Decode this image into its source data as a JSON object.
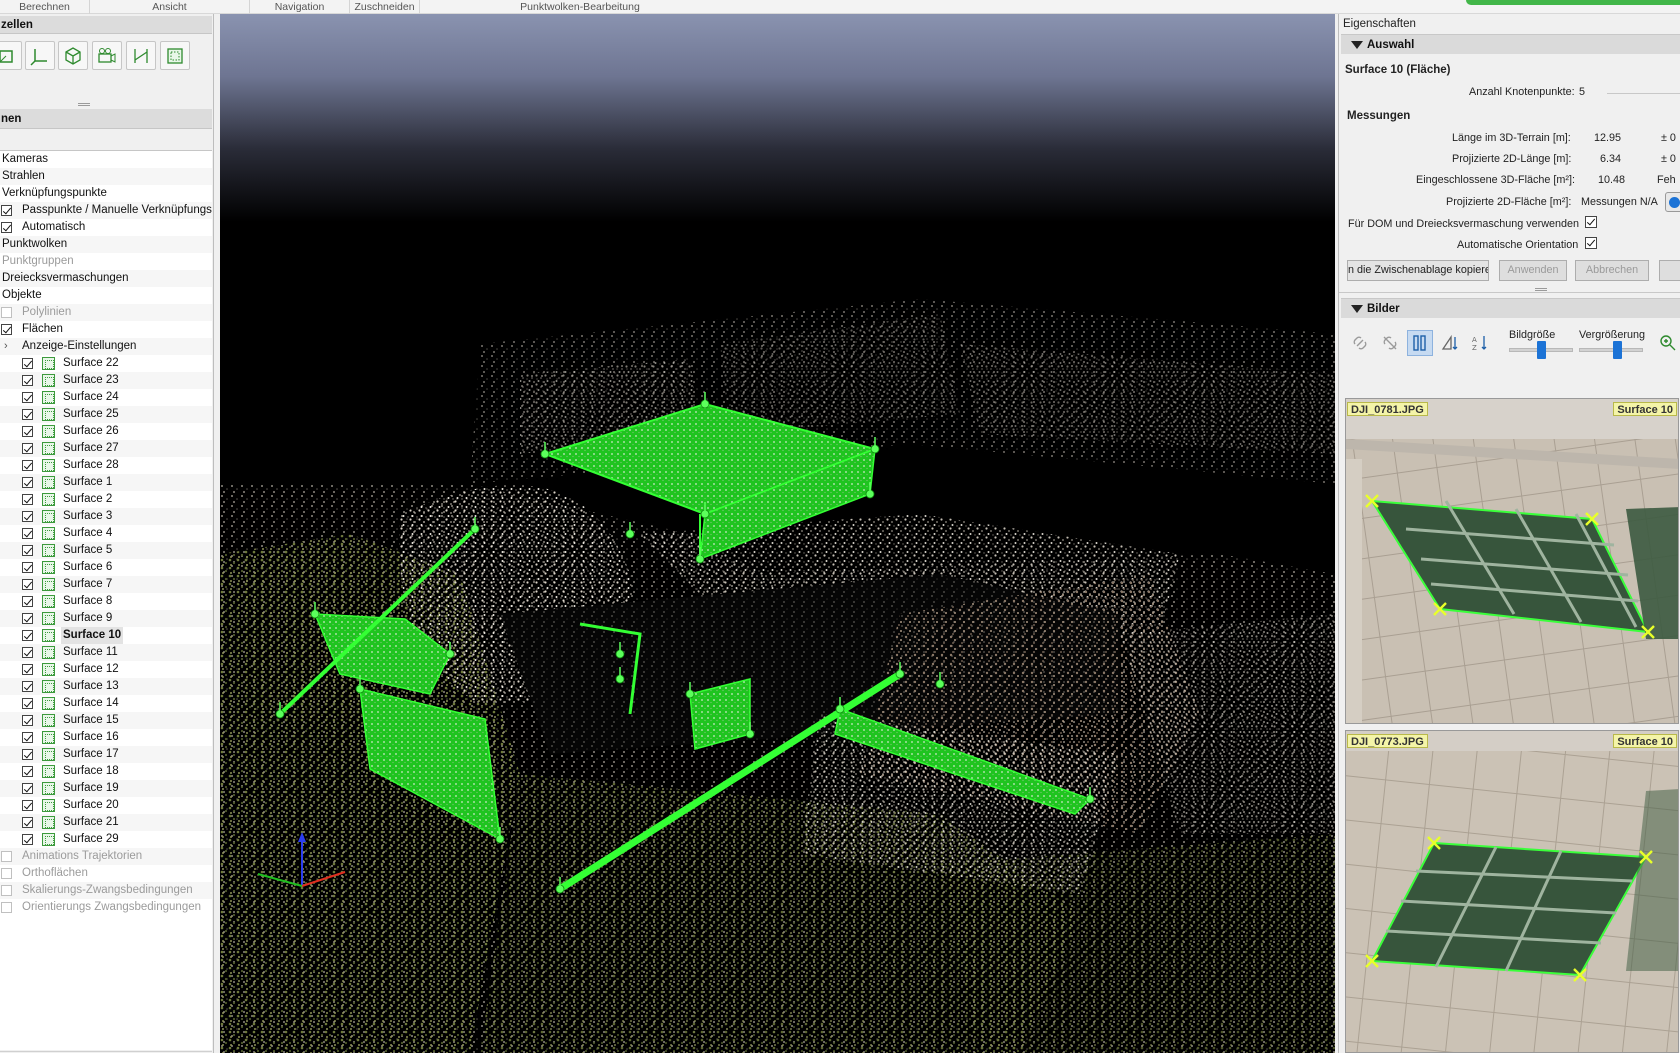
{
  "ribbon": {
    "groups": [
      "Berechnen",
      "Ansicht",
      "Navigation",
      "Zuschneiden",
      "Punktwolken-Bearbeitung"
    ]
  },
  "left": {
    "panel1_title": "zellen",
    "panel2_title": "nen",
    "tree": [
      {
        "label": "Kameras",
        "indent": 0,
        "checkbox": "none",
        "state": "normal"
      },
      {
        "label": "Strahlen",
        "indent": 0,
        "checkbox": "none",
        "state": "normal"
      },
      {
        "label": "Verknüpfungspunkte",
        "indent": 0,
        "checkbox": "none",
        "state": "normal"
      },
      {
        "label": "Passpunkte / Manuelle Verknüpfungspunkte",
        "indent": 0,
        "checkbox": "on",
        "state": "normal"
      },
      {
        "label": "Automatisch",
        "indent": 0,
        "checkbox": "on",
        "state": "normal"
      },
      {
        "label": "Punktwolken",
        "indent": 0,
        "checkbox": "none",
        "state": "normal"
      },
      {
        "label": "Punktgruppen",
        "indent": 0,
        "checkbox": "none",
        "state": "disabled"
      },
      {
        "label": "Dreiecksvermaschungen",
        "indent": 0,
        "checkbox": "none",
        "state": "normal"
      },
      {
        "label": "Objekte",
        "indent": 0,
        "checkbox": "none",
        "state": "normal"
      },
      {
        "label": "Polylinien",
        "indent": 0,
        "checkbox": "off",
        "state": "disabled"
      },
      {
        "label": "Flächen",
        "indent": 0,
        "checkbox": "on",
        "state": "normal"
      },
      {
        "label": "Anzeige-Einstellungen",
        "indent": 1,
        "checkbox": "expander",
        "state": "normal"
      },
      {
        "label": "Surface 22",
        "indent": 2,
        "checkbox": "on",
        "state": "surface"
      },
      {
        "label": "Surface 23",
        "indent": 2,
        "checkbox": "on",
        "state": "surface"
      },
      {
        "label": "Surface 24",
        "indent": 2,
        "checkbox": "on",
        "state": "surface"
      },
      {
        "label": "Surface 25",
        "indent": 2,
        "checkbox": "on",
        "state": "surface"
      },
      {
        "label": "Surface 26",
        "indent": 2,
        "checkbox": "on",
        "state": "surface"
      },
      {
        "label": "Surface 27",
        "indent": 2,
        "checkbox": "on",
        "state": "surface"
      },
      {
        "label": "Surface 28",
        "indent": 2,
        "checkbox": "on",
        "state": "surface"
      },
      {
        "label": "Surface 1",
        "indent": 2,
        "checkbox": "on",
        "state": "surface"
      },
      {
        "label": "Surface 2",
        "indent": 2,
        "checkbox": "on",
        "state": "surface"
      },
      {
        "label": "Surface 3",
        "indent": 2,
        "checkbox": "on",
        "state": "surface"
      },
      {
        "label": "Surface 4",
        "indent": 2,
        "checkbox": "on",
        "state": "surface"
      },
      {
        "label": "Surface 5",
        "indent": 2,
        "checkbox": "on",
        "state": "surface"
      },
      {
        "label": "Surface 6",
        "indent": 2,
        "checkbox": "on",
        "state": "surface"
      },
      {
        "label": "Surface 7",
        "indent": 2,
        "checkbox": "on",
        "state": "surface"
      },
      {
        "label": "Surface 8",
        "indent": 2,
        "checkbox": "on",
        "state": "surface"
      },
      {
        "label": "Surface 9",
        "indent": 2,
        "checkbox": "on",
        "state": "surface"
      },
      {
        "label": "Surface 10",
        "indent": 2,
        "checkbox": "on",
        "state": "selected"
      },
      {
        "label": "Surface 11",
        "indent": 2,
        "checkbox": "on",
        "state": "surface"
      },
      {
        "label": "Surface 12",
        "indent": 2,
        "checkbox": "on",
        "state": "surface"
      },
      {
        "label": "Surface 13",
        "indent": 2,
        "checkbox": "on",
        "state": "surface"
      },
      {
        "label": "Surface 14",
        "indent": 2,
        "checkbox": "on",
        "state": "surface"
      },
      {
        "label": "Surface 15",
        "indent": 2,
        "checkbox": "on",
        "state": "surface"
      },
      {
        "label": "Surface 16",
        "indent": 2,
        "checkbox": "on",
        "state": "surface"
      },
      {
        "label": "Surface 17",
        "indent": 2,
        "checkbox": "on",
        "state": "surface"
      },
      {
        "label": "Surface 18",
        "indent": 2,
        "checkbox": "on",
        "state": "surface"
      },
      {
        "label": "Surface 19",
        "indent": 2,
        "checkbox": "on",
        "state": "surface"
      },
      {
        "label": "Surface 20",
        "indent": 2,
        "checkbox": "on",
        "state": "surface"
      },
      {
        "label": "Surface 21",
        "indent": 2,
        "checkbox": "on",
        "state": "surface"
      },
      {
        "label": "Surface 29",
        "indent": 2,
        "checkbox": "on",
        "state": "surface"
      },
      {
        "label": "Animations Trajektorien",
        "indent": 0,
        "checkbox": "off",
        "state": "disabled"
      },
      {
        "label": "Orthoflächen",
        "indent": 0,
        "checkbox": "off",
        "state": "disabled"
      },
      {
        "label": "Skalierungs-Zwangsbedingungen",
        "indent": 0,
        "checkbox": "off",
        "state": "disabled"
      },
      {
        "label": "Orientierungs Zwangsbedingungen",
        "indent": 0,
        "checkbox": "off",
        "state": "disabled"
      }
    ]
  },
  "properties": {
    "title": "Eigenschaften",
    "selection_section": "Auswahl",
    "object_name": "Surface 10 (Fläche)",
    "node_count_label": "Anzahl Knotenpunkte:",
    "node_count": "5",
    "measurements_title": "Messungen",
    "rows": [
      {
        "label": "Länge im 3D-Terrain [m]:",
        "value": "12.95",
        "extra": "± 0"
      },
      {
        "label": "Projizierte 2D-Länge [m]:",
        "value": "6.34",
        "extra": "± 0"
      },
      {
        "label": "Eingeschlossene 3D-Fläche [m²]:",
        "value": "10.48",
        "extra": "Feh"
      },
      {
        "label": "Projizierte 2D-Fläche [m²]:",
        "value": "Messungen N/A",
        "extra": ""
      }
    ],
    "dom_label": "Für DOM und Dreiecksvermaschung verwenden",
    "auto_orient_label": "Automatische Orientation",
    "copy_button": "n die Zwischenablage kopiere",
    "apply_button": "Anwenden",
    "cancel_button": "Abbrechen"
  },
  "images": {
    "section": "Bilder",
    "size_label": "Bildgröße",
    "zoom_label": "Vergrößerung",
    "size_level": 0.5,
    "zoom_level": 0.6,
    "cards": [
      {
        "file": "DJI_0781.JPG",
        "tag": "Surface 10"
      },
      {
        "file": "DJI_0773.JPG",
        "tag": "Surface 10"
      }
    ]
  },
  "colors": {
    "accent_green": "#2fd62f",
    "selection_blue": "#1c73d6",
    "ribbon_green": "#42b649"
  },
  "icons": [
    "calibrate-icon",
    "axes-icon",
    "cube-icon",
    "camera-icon",
    "tiepoint-icon",
    "surface-icon",
    "link-icon",
    "unlink-icon",
    "filter-icon",
    "sort-angle-icon",
    "sort-az-icon",
    "zoom-in-icon"
  ]
}
